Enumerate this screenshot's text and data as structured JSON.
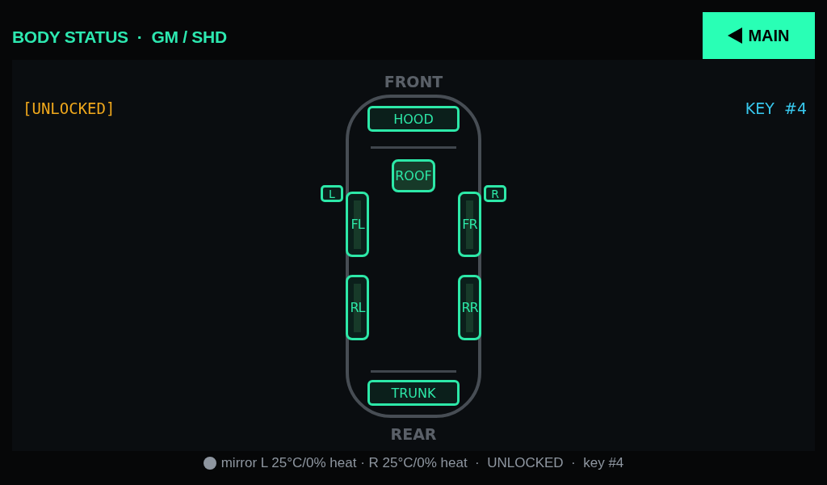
{
  "header": {
    "title": "BODY STATUS  ·  GM / SHD",
    "main_button": {
      "label": "MAIN"
    }
  },
  "lock_status": {
    "label": "[UNLOCKED]",
    "locked": false
  },
  "key": {
    "label": "KEY  #4"
  },
  "diagram": {
    "front_label": "FRONT",
    "parts": [
      {
        "kind": "hood",
        "label": "HOOD",
        "open": false
      },
      {
        "kind": "roof",
        "label": "ROOF",
        "open": false
      },
      {
        "kind": "door",
        "label": "FL",
        "open": false
      },
      {
        "kind": "door",
        "label": "FR",
        "open": false
      },
      {
        "kind": "door",
        "label": "RL",
        "open": false
      },
      {
        "kind": "door",
        "label": "RR",
        "open": false
      },
      {
        "kind": "trunk",
        "label": "TRUNK",
        "open": false
      }
    ],
    "mirrors": [
      {
        "label": "L"
      },
      {
        "label": "R"
      }
    ],
    "rear_label": "REAR"
  },
  "footer": {
    "text": "mirror L 25°C/0% heat · R 25°C/0% heat  ·  UNLOCKED  ·  key #4"
  }
}
